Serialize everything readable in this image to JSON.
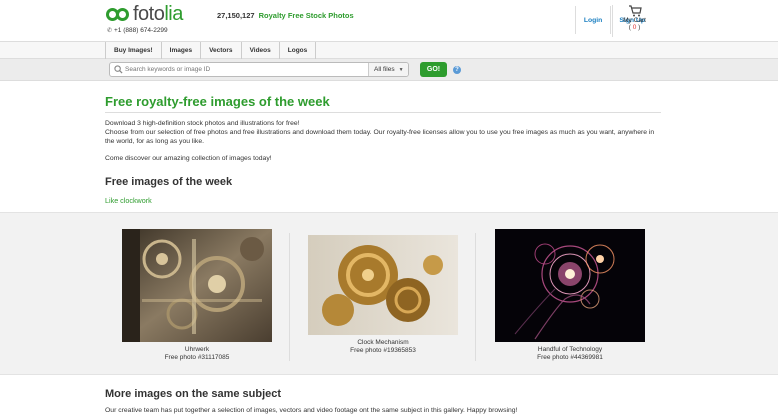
{
  "header": {
    "logo_text_a": "foto",
    "logo_text_b": "lia",
    "phone": "+1 (888) 674-2299",
    "count_number": "27,150,127",
    "count_label": "Royalty Free Stock Photos",
    "login": "Login",
    "signup": "Sign Up",
    "cart_label": "My Cart",
    "cart_count_open": "( ",
    "cart_count": "0",
    "cart_count_close": " )"
  },
  "nav": {
    "items": [
      "Buy Images!",
      "Images",
      "Vectors",
      "Videos",
      "Logos"
    ]
  },
  "search": {
    "placeholder": "Search keywords or image ID",
    "filter": "All files",
    "go": "GO!",
    "help": "?"
  },
  "main": {
    "title": "Free royalty-free images of the week",
    "intro_line1": "Download 3 high-definition stock photos and illustrations for free!",
    "intro_line2": "Choose from our selection of free photos and free illustrations and download them today. Our royalty-free licenses allow you to use you free images as much as you want, anywhere in the world, for as long as you like.",
    "discover": "Come discover our amazing collection of images today!",
    "week_title": "Free images of the week",
    "like": "Like clockwork",
    "cards": [
      {
        "title": "Uhrwerk",
        "subtitle": "Free photo #31117085"
      },
      {
        "title": "Clock Mechanism",
        "subtitle": "Free photo #19365853"
      },
      {
        "title": "Handful of Technology",
        "subtitle": "Free photo #44369981"
      }
    ],
    "more_title": "More images on the same subject",
    "more_text": "Our creative team has put together a selection of images, vectors and video footage ont the same subject in this gallery. Happy browsing!"
  },
  "colors": {
    "brand_green": "#2e9c2e",
    "link_blue": "#1a7fc1",
    "cart_count_red": "#d33"
  }
}
